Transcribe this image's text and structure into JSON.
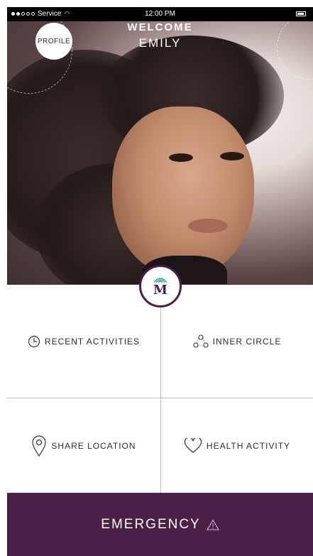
{
  "status_bar": {
    "carrier": "Service",
    "time": "12:00 PM"
  },
  "header": {
    "profile_label": "PROFILE",
    "welcome": "WELCOME",
    "name": "EMILY"
  },
  "logo": {
    "letter": "M"
  },
  "tiles": {
    "recent": "RECENT ACTIVITIES",
    "inner": "INNER CIRCLE",
    "share": "SHARE LOCATION",
    "health": "HEALTH ACTIVITY"
  },
  "emergency_label": "EMERGENCY",
  "colors": {
    "brand": "#4c1f48",
    "accent": "#3aa49a"
  },
  "icons": [
    "wifi-icon",
    "battery-icon",
    "clock-icon",
    "inner-circle-icon",
    "location-pin-icon",
    "heart-icon",
    "warning-icon",
    "signal-icon"
  ]
}
